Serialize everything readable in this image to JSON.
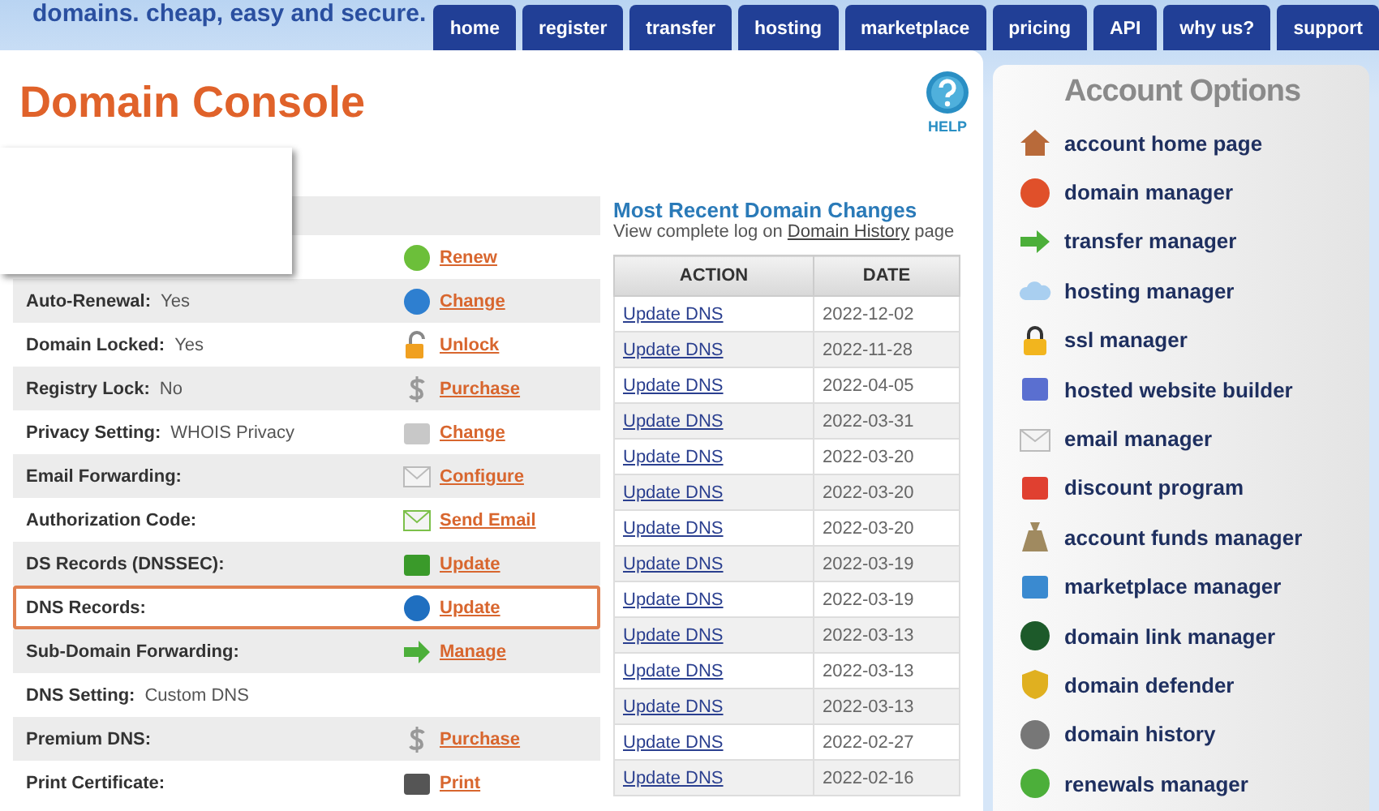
{
  "banner": {
    "tagline": "domains. cheap, easy and secure."
  },
  "nav": [
    {
      "label": "home"
    },
    {
      "label": "register"
    },
    {
      "label": "transfer"
    },
    {
      "label": "hosting"
    },
    {
      "label": "marketplace"
    },
    {
      "label": "pricing"
    },
    {
      "label": "API"
    },
    {
      "label": "why us?"
    },
    {
      "label": "support"
    }
  ],
  "page_title": "Domain Console",
  "help": {
    "label": "HELP"
  },
  "settings": [
    {
      "action": "Renew",
      "highlighted": false
    },
    {
      "label": "Auto-Renewal:",
      "value": "Yes",
      "action": "Change",
      "highlighted": false
    },
    {
      "label": "Domain Locked:",
      "value": "Yes",
      "action": "Unlock",
      "highlighted": false
    },
    {
      "label": "Registry Lock:",
      "value": "No",
      "action": "Purchase",
      "highlighted": false
    },
    {
      "label": "Privacy Setting:",
      "value": "WHOIS Privacy",
      "action": "Change",
      "highlighted": false
    },
    {
      "label": "Email Forwarding:",
      "action": "Configure",
      "highlighted": false
    },
    {
      "label": "Authorization Code:",
      "action": "Send Email",
      "highlighted": false
    },
    {
      "label": "DS Records (DNSSEC):",
      "action": "Update",
      "highlighted": false
    },
    {
      "label": "DNS Records:",
      "action": "Update",
      "highlighted": true
    },
    {
      "label": "Sub-Domain Forwarding:",
      "action": "Manage",
      "highlighted": false
    },
    {
      "label": "DNS Setting:",
      "value": "Custom DNS",
      "highlighted": false
    },
    {
      "label": "Premium DNS:",
      "action": "Purchase",
      "highlighted": false
    },
    {
      "label": "Print Certificate:",
      "action": "Print",
      "highlighted": false
    }
  ],
  "changes": {
    "title": "Most Recent Domain Changes",
    "intro_before": "View complete log on",
    "intro_link": "Domain History",
    "intro_after": "page",
    "columns": [
      "ACTION",
      "DATE"
    ],
    "rows": [
      {
        "action": "Update DNS",
        "date": "2022-12-02"
      },
      {
        "action": "Update DNS",
        "date": "2022-11-28"
      },
      {
        "action": "Update DNS",
        "date": "2022-04-05"
      },
      {
        "action": "Update DNS",
        "date": "2022-03-31"
      },
      {
        "action": "Update DNS",
        "date": "2022-03-20"
      },
      {
        "action": "Update DNS",
        "date": "2022-03-20"
      },
      {
        "action": "Update DNS",
        "date": "2022-03-20"
      },
      {
        "action": "Update DNS",
        "date": "2022-03-19"
      },
      {
        "action": "Update DNS",
        "date": "2022-03-19"
      },
      {
        "action": "Update DNS",
        "date": "2022-03-13"
      },
      {
        "action": "Update DNS",
        "date": "2022-03-13"
      },
      {
        "action": "Update DNS",
        "date": "2022-03-13"
      },
      {
        "action": "Update DNS",
        "date": "2022-02-27"
      },
      {
        "action": "Update DNS",
        "date": "2022-02-16"
      }
    ]
  },
  "account_options": {
    "title": "Account Options",
    "items": [
      "account home page",
      "domain manager",
      "transfer manager",
      "hosting manager",
      "ssl manager",
      "hosted website builder",
      "email manager",
      "discount program",
      "account funds manager",
      "marketplace manager",
      "domain link manager",
      "domain defender",
      "domain history",
      "renewals manager"
    ]
  }
}
